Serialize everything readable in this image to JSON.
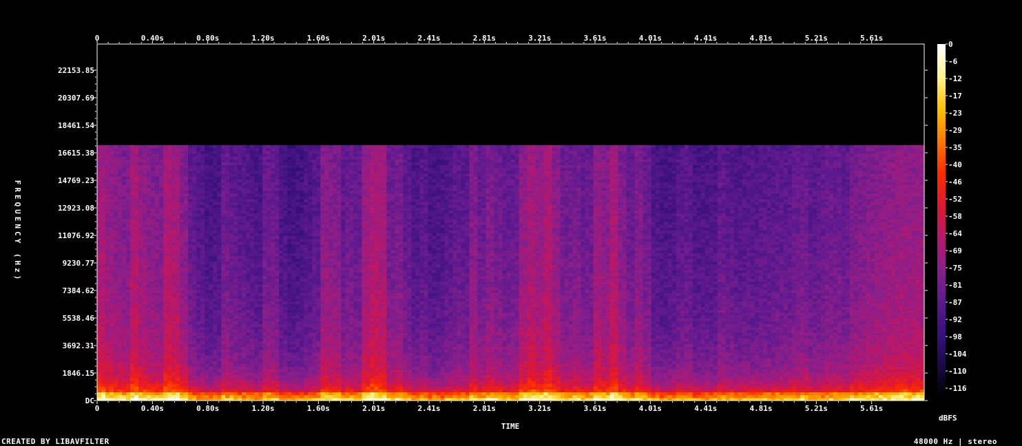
{
  "chart_data": {
    "type": "heatmap",
    "title": "",
    "xlabel": "TIME",
    "ylabel": "FREQUENCY (Hz)",
    "x_ticks": [
      "0",
      "0.40s",
      "0.80s",
      "1.20s",
      "1.60s",
      "2.01s",
      "2.41s",
      "2.81s",
      "3.21s",
      "3.61s",
      "4.01s",
      "4.41s",
      "4.81s",
      "5.21s",
      "5.61s"
    ],
    "x_range": [
      0,
      6.0
    ],
    "y_ticks": [
      "DC",
      "1846.15",
      "3692.31",
      "5538.46",
      "7384.62",
      "9230.77",
      "11076.92",
      "12923.08",
      "14769.23",
      "16615.38",
      "18461.54",
      "20307.69",
      "22153.85"
    ],
    "y_range": [
      0,
      24000
    ],
    "colorbar": {
      "label": "dBFS",
      "ticks": [
        "0",
        "-6",
        "-12",
        "-17",
        "-23",
        "-29",
        "-35",
        "-40",
        "-46",
        "-52",
        "-58",
        "-64",
        "-69",
        "-75",
        "-81",
        "-87",
        "-92",
        "-98",
        "-104",
        "-110",
        "-116"
      ],
      "range": [
        -120,
        0
      ]
    },
    "cutoff_hz": 17200,
    "energy_profile_db": [
      -72,
      -76,
      -78,
      -80,
      -70,
      -76,
      -79,
      -80,
      -70,
      -72,
      -79,
      -88,
      -92,
      -95,
      -94,
      -85,
      -88,
      -90,
      -92,
      -94,
      -85,
      -86,
      -94,
      -97,
      -96,
      -93,
      -90,
      -78,
      -80,
      -88,
      -85,
      -87,
      -74,
      -70,
      -72,
      -84,
      -82,
      -88,
      -93,
      -90,
      -95,
      -94,
      -91,
      -88,
      -89,
      -80,
      -86,
      -81,
      -84,
      -87,
      -86,
      -76,
      -72,
      -75,
      -70,
      -77,
      -84,
      -82,
      -86,
      -85,
      -75,
      -78,
      -71,
      -80,
      -86,
      -80,
      -85,
      -93,
      -95,
      -94,
      -90,
      -89,
      -94,
      -93,
      -93,
      -88,
      -90,
      -92,
      -91,
      -91,
      -90,
      -90,
      -89,
      -89,
      -86,
      -85,
      -89,
      -88,
      -85,
      -85,
      -87,
      -82,
      -81,
      -79,
      -78,
      -77,
      -76,
      -75,
      -76,
      -75
    ],
    "colors": [
      "#000000",
      "#1a0b4a",
      "#3a117e",
      "#5e1a8f",
      "#8a1f8a",
      "#b8186a",
      "#e0182f",
      "#ff2c00",
      "#ff7a00",
      "#ffc200",
      "#fff38a",
      "#ffffff"
    ]
  },
  "footer": {
    "left": "CREATED BY LIBAVFILTER",
    "right": "48000 Hz | stereo"
  }
}
